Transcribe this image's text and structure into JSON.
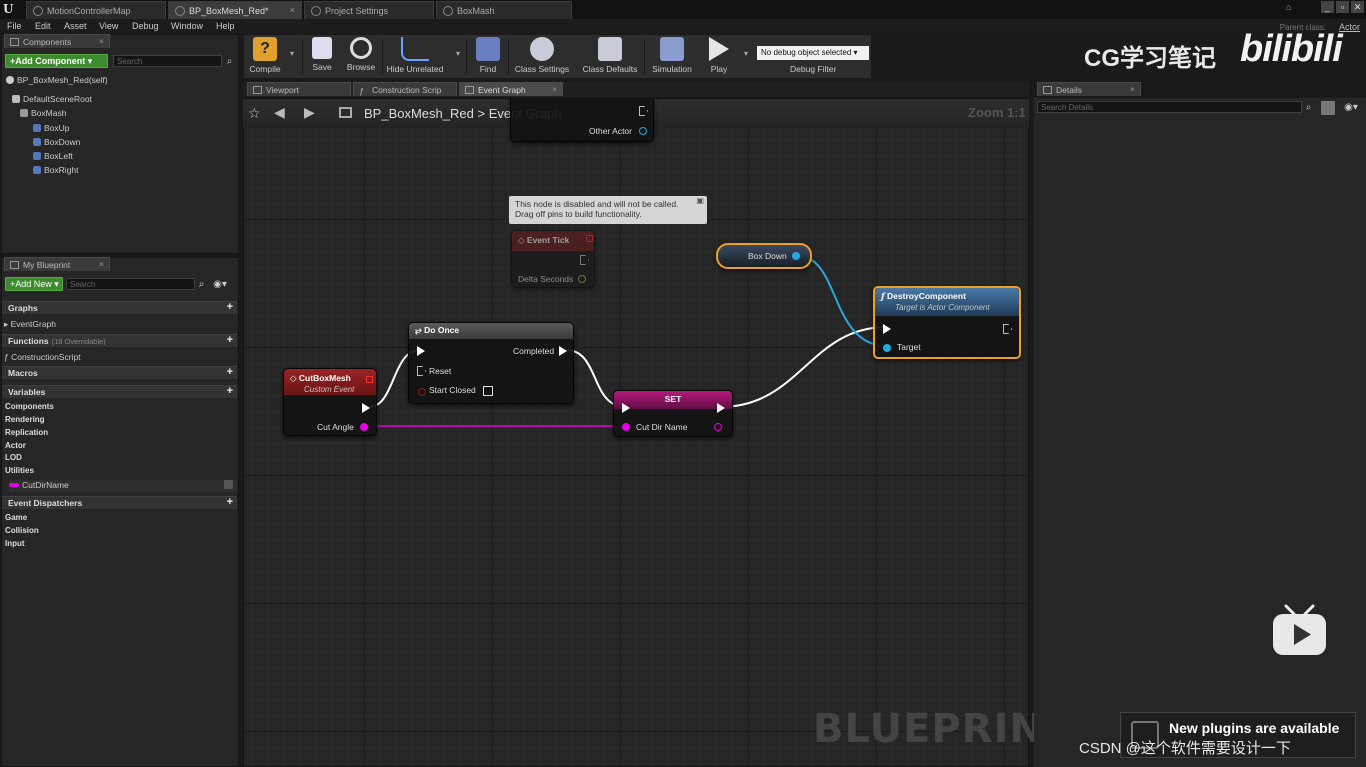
{
  "title_bar": {
    "tabs": [
      {
        "label": "MotionControllerMap",
        "active": false
      },
      {
        "label": "BP_BoxMesh_Red*",
        "active": true
      },
      {
        "label": "Project Settings",
        "active": false
      },
      {
        "label": "BoxMash",
        "active": false
      }
    ],
    "window_buttons": [
      "_",
      "▫",
      "✕"
    ]
  },
  "menu": {
    "items": [
      "File",
      "Edit",
      "Asset",
      "View",
      "Debug",
      "Window",
      "Help"
    ],
    "parent_class_label": "Parent class:",
    "parent_class_value": "Actor"
  },
  "components_panel": {
    "tab_label": "Components",
    "add_button": "+Add Component ▾",
    "search_placeholder": "Search",
    "self_item": "BP_BoxMesh_Red(self)",
    "tree": [
      "DefaultSceneRoot",
      "BoxMash",
      "BoxUp",
      "BoxDown",
      "BoxLeft",
      "BoxRight"
    ]
  },
  "my_blueprint": {
    "tab_label": "My Blueprint",
    "add_new": "+Add New ▾",
    "search_placeholder": "Search",
    "graphs_label": "Graphs",
    "event_graph": "EventGraph",
    "functions_label": "Functions",
    "functions_sub": "(18 Overridable)",
    "construction_script": "ConstructionScript",
    "macros_label": "Macros",
    "variables_label": "Variables",
    "variable_groups": [
      "Components",
      "Rendering",
      "Replication",
      "Actor",
      "LOD",
      "Utilities"
    ],
    "variable_item": "CutDirName",
    "dispatchers_label": "Event Dispatchers",
    "dispatcher_groups": [
      "Game",
      "Collision",
      "Input"
    ]
  },
  "toolbar": {
    "compile": "Compile",
    "save": "Save",
    "browse": "Browse",
    "hide_unrelated": "Hide Unrelated",
    "find": "Find",
    "class_settings": "Class Settings",
    "class_defaults": "Class Defaults",
    "simulation": "Simulation",
    "play": "Play",
    "debug_object": "No debug object selected ▾",
    "debug_filter": "Debug Filter"
  },
  "graph_tabs": [
    {
      "label": "Viewport",
      "active": false
    },
    {
      "label": "Construction Scrip",
      "active": false
    },
    {
      "label": "Event Graph",
      "active": true
    }
  ],
  "graph": {
    "breadcrumb_root": "BP_BoxMesh_Red",
    "breadcrumb_sep": ">",
    "breadcrumb_leaf": "Event Graph",
    "zoom": "Zoom 1:1",
    "watermark": "BLUEPRINT",
    "partial_node_pin": "Other Actor",
    "disabled_comment_line1": "This node is disabled and will not be called.",
    "disabled_comment_line2": "Drag off pins to build functionality.",
    "event_tick_title": "Event Tick",
    "event_tick_pin": "Delta Seconds",
    "custom_event_title": "CutBoxMesh",
    "custom_event_sub": "Custom Event",
    "custom_event_pin": "Cut Angle",
    "do_once_title": "Do Once",
    "do_once_completed": "Completed",
    "do_once_reset": "Reset",
    "do_once_start_closed": "Start Closed",
    "set_title": "SET",
    "set_pin": "Cut Dir Name",
    "box_down_label": "Box Down",
    "destroy_title": "DestroyComponent",
    "destroy_sub": "Target is Actor Component",
    "destroy_target": "Target"
  },
  "details_panel": {
    "tab_label": "Details",
    "search_placeholder": "Search Details"
  },
  "overlays": {
    "site_logo": "CG学习笔记",
    "bili_logo": "bilibili",
    "notification_title": "New plugins are available",
    "csdn": "CSDN @这个软件需要设计一下"
  },
  "colors": {
    "event_red": "#8c1e1e",
    "exec_white": "#ffffff",
    "string_magenta": "#e600e6",
    "object_blue": "#26a9e0",
    "float_green": "#7ac84a",
    "function_blue": "#3a6a94",
    "highlight_orange": "#f0a020"
  }
}
